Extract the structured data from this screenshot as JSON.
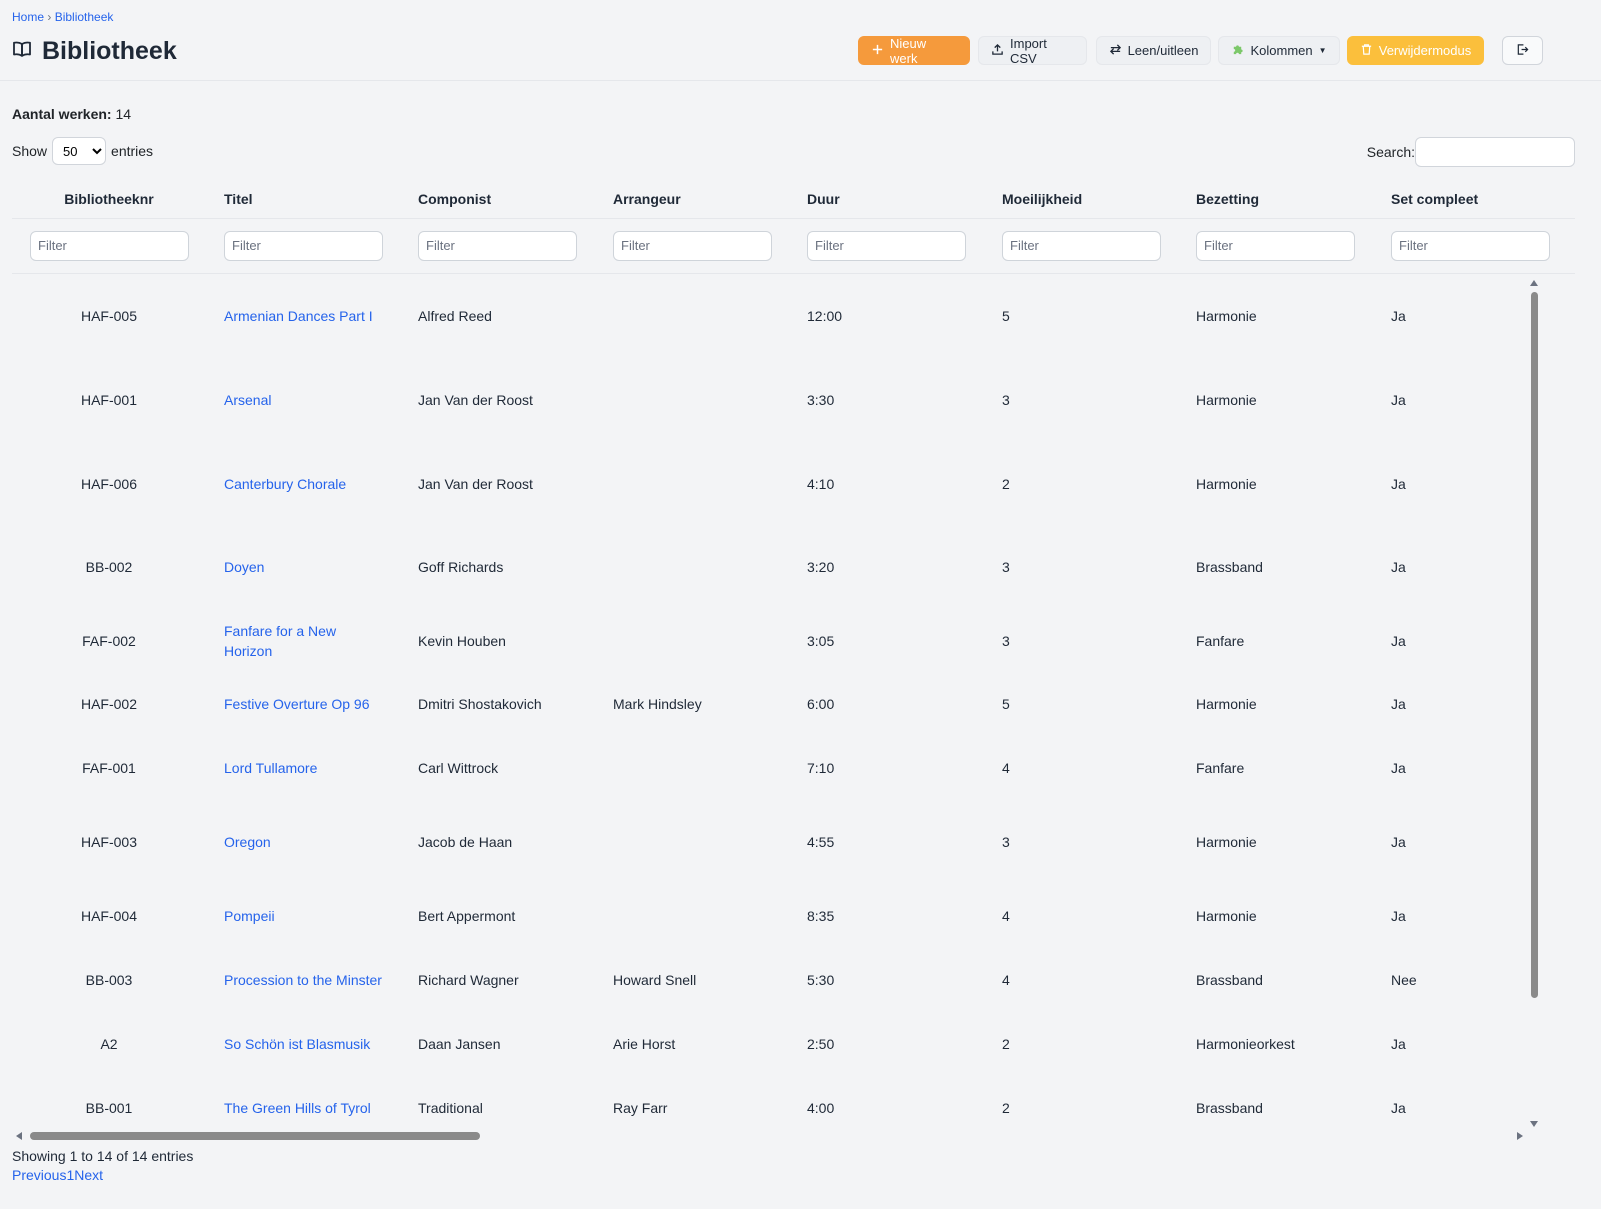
{
  "breadcrumb": {
    "home": "Home",
    "separator": "›",
    "current": "Bibliotheek"
  },
  "page": {
    "title": "Bibliotheek",
    "icon": "book-open-icon"
  },
  "toolbar": {
    "new_label": "Nieuw werk",
    "import_label": "Import CSV",
    "lend_label": "Leen/uitleen",
    "columns_label": "Kolommen",
    "delete_mode_label": "Verwijdermodus",
    "logout_icon": "logout-icon",
    "colors": {
      "primary": "#f59a3c",
      "warning": "#fbbf3c"
    }
  },
  "summary": {
    "label": "Aantal werken:",
    "count": "14"
  },
  "length": {
    "before": "Show",
    "value": "50",
    "after": "entries"
  },
  "search": {
    "label": "Search:",
    "value": ""
  },
  "table": {
    "columns": [
      "Bibliotheeknr",
      "Titel",
      "Componist",
      "Arrangeur",
      "Duur",
      "Moeilijkheid",
      "Bezetting",
      "Set compleet"
    ],
    "filter_placeholder": "Filter",
    "rows": [
      {
        "nr": "HAF-005",
        "titel": "Armenian Dances Part I",
        "componist": "Alfred Reed",
        "arrangeur": "",
        "duur": "12:00",
        "moeilijkheid": "5",
        "bezetting": "Harmonie",
        "set": "Ja"
      },
      {
        "nr": "HAF-001",
        "titel": "Arsenal",
        "componist": "Jan Van der Roost",
        "arrangeur": "",
        "duur": "3:30",
        "moeilijkheid": "3",
        "bezetting": "Harmonie",
        "set": "Ja"
      },
      {
        "nr": "HAF-006",
        "titel": "Canterbury Chorale",
        "componist": "Jan Van der Roost",
        "arrangeur": "",
        "duur": "4:10",
        "moeilijkheid": "2",
        "bezetting": "Harmonie",
        "set": "Ja"
      },
      {
        "nr": "BB-002",
        "titel": "Doyen",
        "componist": "Goff Richards",
        "arrangeur": "",
        "duur": "3:20",
        "moeilijkheid": "3",
        "bezetting": "Brassband",
        "set": "Ja"
      },
      {
        "nr": "FAF-002",
        "titel": "Fanfare for a New Horizon",
        "componist": "Kevin Houben",
        "arrangeur": "",
        "duur": "3:05",
        "moeilijkheid": "3",
        "bezetting": "Fanfare",
        "set": "Ja"
      },
      {
        "nr": "HAF-002",
        "titel": "Festive Overture Op 96",
        "componist": "Dmitri Shostakovich",
        "arrangeur": "Mark Hindsley",
        "duur": "6:00",
        "moeilijkheid": "5",
        "bezetting": "Harmonie",
        "set": "Ja"
      },
      {
        "nr": "FAF-001",
        "titel": "Lord Tullamore",
        "componist": "Carl Wittrock",
        "arrangeur": "",
        "duur": "7:10",
        "moeilijkheid": "4",
        "bezetting": "Fanfare",
        "set": "Ja"
      },
      {
        "nr": "HAF-003",
        "titel": "Oregon",
        "componist": "Jacob de Haan",
        "arrangeur": "",
        "duur": "4:55",
        "moeilijkheid": "3",
        "bezetting": "Harmonie",
        "set": "Ja"
      },
      {
        "nr": "HAF-004",
        "titel": "Pompeii",
        "componist": "Bert Appermont",
        "arrangeur": "",
        "duur": "8:35",
        "moeilijkheid": "4",
        "bezetting": "Harmonie",
        "set": "Ja"
      },
      {
        "nr": "BB-003",
        "titel": "Procession to the Minster",
        "componist": "Richard Wagner",
        "arrangeur": "Howard Snell",
        "duur": "5:30",
        "moeilijkheid": "4",
        "bezetting": "Brassband",
        "set": "Nee"
      },
      {
        "nr": "A2",
        "titel": "So Schön ist Blasmusik",
        "componist": "Daan Jansen",
        "arrangeur": "Arie Horst",
        "duur": "2:50",
        "moeilijkheid": "2",
        "bezetting": "Harmonieorkest",
        "set": "Ja"
      },
      {
        "nr": "BB-001",
        "titel": "The Green Hills of Tyrol",
        "componist": "Traditional",
        "arrangeur": "Ray Farr",
        "duur": "4:00",
        "moeilijkheid": "2",
        "bezetting": "Brassband",
        "set": "Ja"
      }
    ]
  },
  "footer": {
    "info": "Showing 1 to 14 of 14 entries",
    "previous": "Previous",
    "page": "1",
    "next": "Next"
  }
}
